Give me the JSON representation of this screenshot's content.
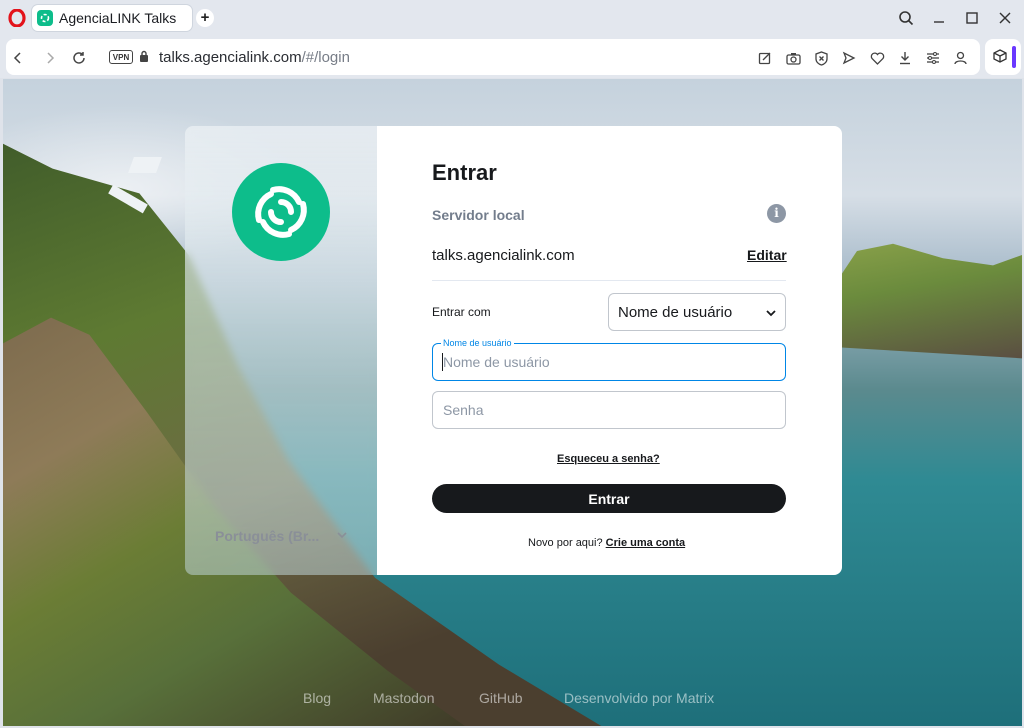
{
  "browser": {
    "tab_title": "AgenciaLINK Talks",
    "new_tab": "+",
    "vpn_badge": "VPN",
    "url_host": "talks.agencialink.com",
    "url_path": "/#/login"
  },
  "login": {
    "title": "Entrar",
    "server_label": "Servidor local",
    "info_icon": "i",
    "server_value": "talks.agencialink.com",
    "edit_label": "Editar",
    "login_with_label": "Entrar com",
    "login_with_value": "Nome de usuário",
    "username_floating_label": "Nome de usuário",
    "username_placeholder": "Nome de usuário",
    "password_placeholder": "Senha",
    "forgot_label": "Esqueceu a senha?",
    "submit_label": "Entrar",
    "new_here_text": "Novo por aqui?",
    "create_account_label": "Crie uma conta",
    "language": "Português (Br..."
  },
  "footer": {
    "blog": "Blog",
    "mastodon": "Mastodon",
    "github": "GitHub",
    "powered": "Desenvolvido por Matrix"
  },
  "colors": {
    "accent": "#0dbd8b",
    "focus": "#0086e6",
    "button": "#17191c",
    "opera_red": "#e3131b"
  }
}
